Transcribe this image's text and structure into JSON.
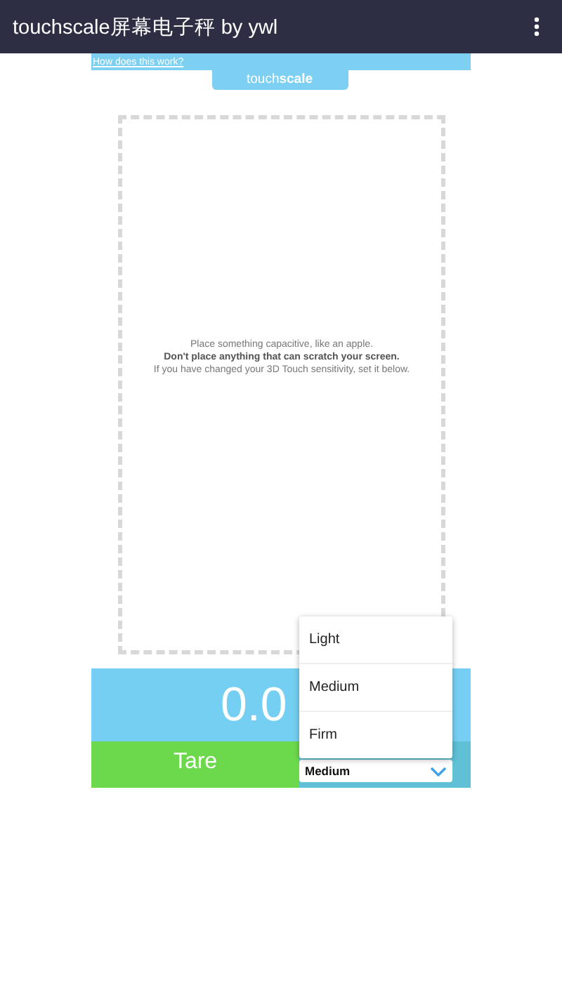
{
  "app_bar": {
    "title": "touchscale屏幕电子秤 by ywl"
  },
  "help_link": "How does this work?",
  "brand_tab": {
    "text": "touch**scale**"
  },
  "instructions": [
    "Place something capacitive, like an apple.",
    "Don't place anything that can scratch your screen.",
    "If you have changed your 3D Touch sensitivity, set it below."
  ],
  "reading": "0.0",
  "tare_button": "Tare",
  "sensitivity_select": {
    "value": "Medium"
  },
  "sensitivity_menu": [
    "Light",
    "Medium",
    "Firm"
  ]
}
